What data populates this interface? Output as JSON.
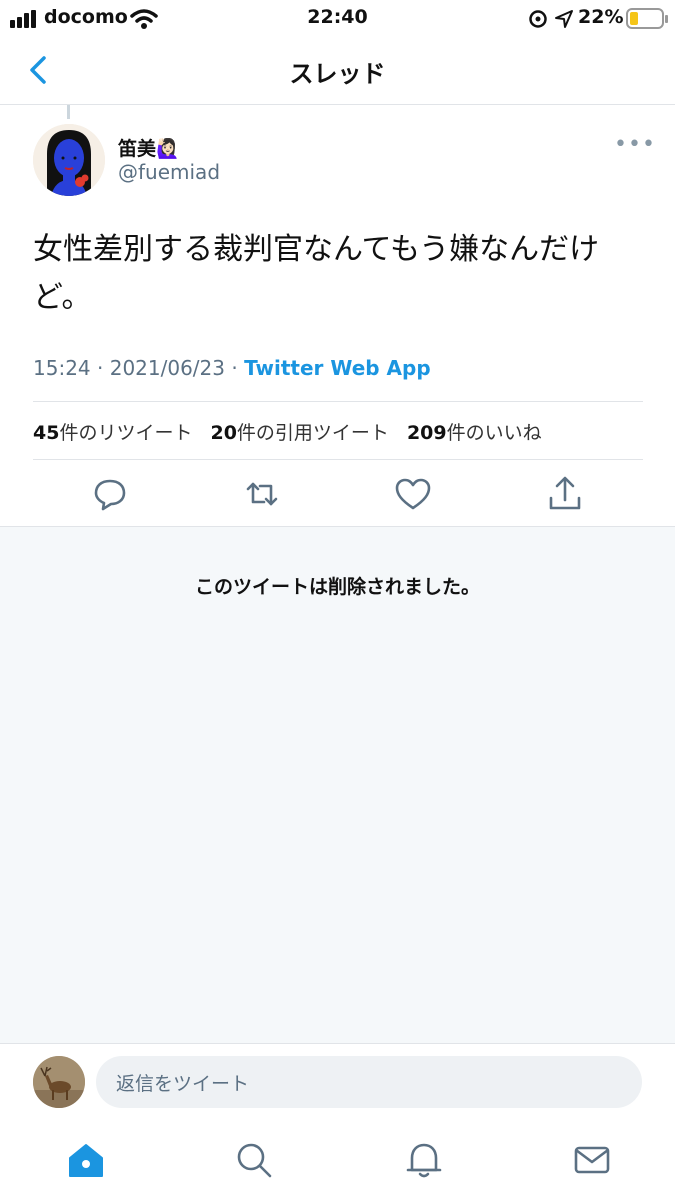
{
  "status_bar": {
    "carrier": "docomo",
    "time": "22:40",
    "battery": "22%"
  },
  "nav": {
    "title": "スレッド"
  },
  "tweet": {
    "display_name": "笛美🙋🏻‍♀️",
    "handle": "@fuemiad",
    "text": "女性差別する裁判官なんてもう嫌なんだけど。",
    "time": "15:24",
    "date": "2021/06/23",
    "dot": "·",
    "source": "Twitter Web App",
    "retweet_count": "45",
    "retweet_label": "件のリツイート",
    "quote_count": "20",
    "quote_label": "件の引用ツイート",
    "like_count": "209",
    "like_label": "件のいいね"
  },
  "deleted_notice": "このツイートは削除されました。",
  "reply": {
    "placeholder": "返信をツイート"
  },
  "icons": {
    "back": "chevron-left-icon",
    "more": "more-icon",
    "reply": "reply-icon",
    "retweet": "retweet-icon",
    "like": "heart-icon",
    "share": "share-icon",
    "home": "home-icon",
    "search": "search-icon",
    "notifications": "bell-icon",
    "messages": "mail-icon"
  },
  "colors": {
    "accent": "#1b95e0",
    "meta_grey": "#5b7083",
    "battery_fill": "#f5c518"
  }
}
